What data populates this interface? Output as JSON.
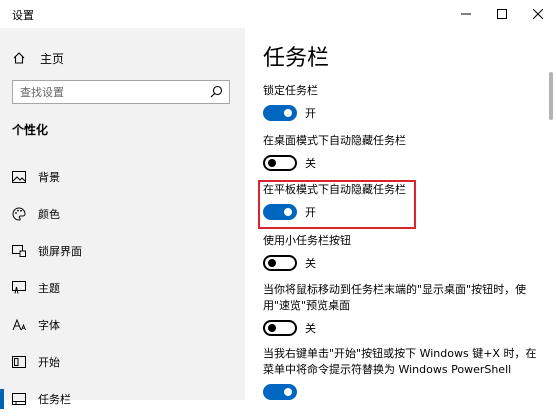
{
  "window": {
    "title": "设置"
  },
  "sidebar": {
    "home_label": "主页",
    "search_placeholder": "查找设置",
    "section_title": "个性化",
    "items": [
      {
        "label": "背景",
        "icon": "picture-icon",
        "active": false
      },
      {
        "label": "颜色",
        "icon": "palette-icon",
        "active": false
      },
      {
        "label": "锁屏界面",
        "icon": "lock-screen-icon",
        "active": false
      },
      {
        "label": "主题",
        "icon": "theme-icon",
        "active": false
      },
      {
        "label": "字体",
        "icon": "font-icon",
        "active": false
      },
      {
        "label": "开始",
        "icon": "start-icon",
        "active": false
      },
      {
        "label": "任务栏",
        "icon": "taskbar-icon",
        "active": true
      }
    ]
  },
  "main": {
    "title": "任务栏",
    "settings": [
      {
        "label": "锁定任务栏",
        "state": "开",
        "on": true
      },
      {
        "label": "在桌面模式下自动隐藏任务栏",
        "state": "关",
        "on": false
      },
      {
        "label": "在平板模式下自动隐藏任务栏",
        "state": "开",
        "on": true
      },
      {
        "label": "使用小任务栏按钮",
        "state": "关",
        "on": false
      },
      {
        "label": "当你将鼠标移动到任务栏末端的\"显示桌面\"按钮时，使用\"速览\"预览桌面",
        "state": "关",
        "on": false
      },
      {
        "label": "当我右键单击\"开始\"按钮或按下 Windows 键+X 时，在菜单中将命令提示符替换为 Windows PowerShell",
        "state": "",
        "on": true
      }
    ]
  },
  "colors": {
    "accent": "#0067c0",
    "highlight_box": "#d9262c",
    "sidebar_bg": "#f2f2f2"
  }
}
